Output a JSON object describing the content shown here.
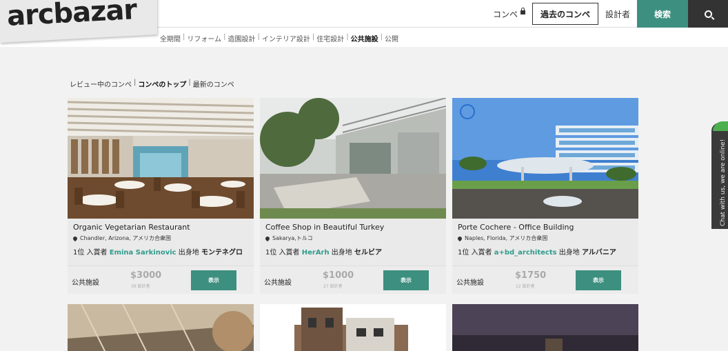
{
  "header": {
    "logo": "arcbazar",
    "nav_competitions": "コンペ",
    "nav_past": "過去のコンペ",
    "nav_designers": "設計者",
    "nav_search": "検索"
  },
  "subnav": {
    "items": [
      {
        "label": "全期間"
      },
      {
        "label": "リフォーム"
      },
      {
        "label": "造園設計"
      },
      {
        "label": "インテリア設計"
      },
      {
        "label": "住宅設計"
      },
      {
        "label": "公共施設"
      },
      {
        "label": "公開"
      }
    ],
    "active": "公共施設"
  },
  "filter": {
    "items": [
      {
        "label": "レビュー中のコンペ"
      },
      {
        "label": "コンペのトップ"
      },
      {
        "label": "最新のコンペ"
      }
    ],
    "active": "コンペのトップ"
  },
  "cards": [
    {
      "title": "Organic Vegetarian Restaurant",
      "location": "Chandler, Arizona, アメリカ合衆国",
      "winner_prefix": "1位 入賞者",
      "winner_name": "Emina Sarkinovic",
      "origin_label": "出身地",
      "origin_country": "モンテネグロ",
      "category": "公共施設",
      "prize": "$3000",
      "designers": "39 設計者",
      "view": "表示"
    },
    {
      "title": "Coffee Shop in Beautiful Turkey",
      "location": "Sakarya,トルコ",
      "winner_prefix": "1位 入賞者",
      "winner_name": "HerArh",
      "origin_label": "出身地",
      "origin_country": "セルビア",
      "category": "公共施設",
      "prize": "$1000",
      "designers": "27 設計者",
      "view": "表示"
    },
    {
      "title": "Porte Cochere - Office Building",
      "location": "Naples, Florida, アメリカ合衆国",
      "winner_prefix": "1位 入賞者",
      "winner_name": "a+bd_architects",
      "origin_label": "出身地",
      "origin_country": "アルバニア",
      "category": "公共施設",
      "prize": "$1750",
      "designers": "12 設計者",
      "view": "表示"
    }
  ],
  "chat": {
    "label": "Chat with us, we are online!"
  },
  "colors": {
    "accent": "#3d8f7f",
    "winner": "#2f9b8c",
    "dark": "#333333",
    "background": "#f2f2f2"
  }
}
